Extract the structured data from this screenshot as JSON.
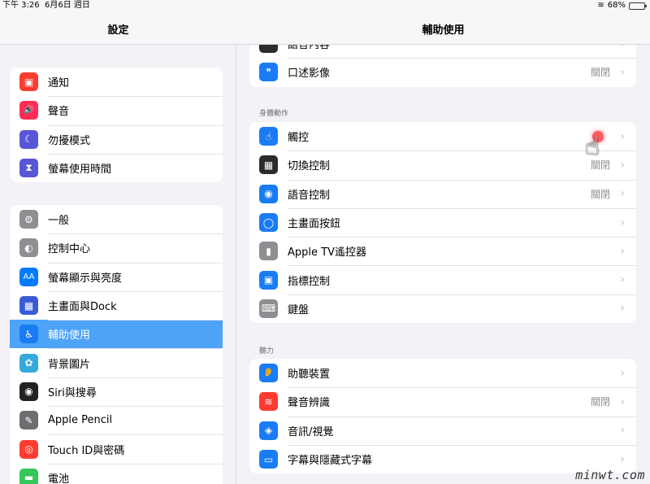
{
  "status": {
    "time": "下午 3:26",
    "date": "6月6日 週日",
    "battery": "68%",
    "battery_level": 0.68
  },
  "left_panel": {
    "title": "設定",
    "group1": [
      {
        "label": "通知",
        "icon": "notification-icon",
        "color": "#ff3b30"
      },
      {
        "label": "聲音",
        "icon": "speaker-icon",
        "color": "#ff2d55"
      },
      {
        "label": "勿擾模式",
        "icon": "moon-icon",
        "color": "#5856d6"
      },
      {
        "label": "螢幕使用時間",
        "icon": "hourglass-icon",
        "color": "#5856d6"
      }
    ],
    "group2": [
      {
        "label": "一般",
        "icon": "gear-icon",
        "color": "#8e8e93"
      },
      {
        "label": "控制中心",
        "icon": "toggles-icon",
        "color": "#8e8e93"
      },
      {
        "label": "螢幕顯示與亮度",
        "icon": "text-size-icon",
        "color": "#007aff"
      },
      {
        "label": "主畫面與Dock",
        "icon": "home-grid-icon",
        "color": "#3a5bd6"
      },
      {
        "label": "輔助使用",
        "icon": "accessibility-icon",
        "color": "#1a7cf5"
      },
      {
        "label": "背景圖片",
        "icon": "flower-icon",
        "color": "#34aadc"
      },
      {
        "label": "Siri與搜尋",
        "icon": "siri-icon",
        "color": "#222"
      },
      {
        "label": "Apple Pencil",
        "icon": "pencil-icon",
        "color": "#6d6d72"
      },
      {
        "label": "Touch ID與密碼",
        "icon": "fingerprint-icon",
        "color": "#ff3b30"
      },
      {
        "label": "電池",
        "icon": "battery-icon",
        "color": "#34c759"
      }
    ]
  },
  "right_panel": {
    "title": "輔助使用",
    "top_group": [
      {
        "label": "語音內容",
        "icon": "speech-bubble-icon",
        "color": "#2c2c2e",
        "value": ""
      },
      {
        "label": "口述影像",
        "icon": "chat-quote-icon",
        "color": "#1a7cf5",
        "value": "關閉"
      }
    ],
    "section_physical": "身體動作",
    "physical_group": [
      {
        "label": "觸控",
        "icon": "hand-touch-icon",
        "color": "#1a7cf5",
        "value": ""
      },
      {
        "label": "切換控制",
        "icon": "switch-grid-icon",
        "color": "#2c2c2e",
        "value": "關閉"
      },
      {
        "label": "語音控制",
        "icon": "voice-control-icon",
        "color": "#1a7cf5",
        "value": "關閉"
      },
      {
        "label": "主畫面按鈕",
        "icon": "home-button-icon",
        "color": "#1a7cf5",
        "value": ""
      },
      {
        "label": "Apple TV遙控器",
        "icon": "remote-icon",
        "color": "#8e8e93",
        "value": ""
      },
      {
        "label": "指標控制",
        "icon": "pointer-icon",
        "color": "#1a7cf5",
        "value": ""
      },
      {
        "label": "鍵盤",
        "icon": "keyboard-icon",
        "color": "#8e8e93",
        "value": ""
      }
    ],
    "section_hearing": "聽力",
    "hearing_group": [
      {
        "label": "助聽裝置",
        "icon": "ear-icon",
        "color": "#1a7cf5",
        "value": ""
      },
      {
        "label": "聲音辨識",
        "icon": "waveform-icon",
        "color": "#ff3b30",
        "value": "關閉"
      },
      {
        "label": "音訊/視覺",
        "icon": "audio-visual-icon",
        "color": "#1a7cf5",
        "value": ""
      },
      {
        "label": "字幕與隱藏式字幕",
        "icon": "captions-icon",
        "color": "#1a7cf5",
        "value": ""
      }
    ]
  },
  "watermark": "minwt.com",
  "glyphs": {
    "notification-icon": "▣",
    "speaker-icon": "🔊",
    "moon-icon": "☾",
    "hourglass-icon": "⧗",
    "gear-icon": "⚙",
    "toggles-icon": "◐",
    "text-size-icon": "AA",
    "home-grid-icon": "▦",
    "accessibility-icon": "♿",
    "flower-icon": "✿",
    "siri-icon": "◉",
    "pencil-icon": "✎",
    "fingerprint-icon": "◎",
    "battery-icon": "▬",
    "speech-bubble-icon": "❝",
    "chat-quote-icon": "❞",
    "hand-touch-icon": "☝",
    "switch-grid-icon": "▦",
    "voice-control-icon": "◉",
    "home-button-icon": "◯",
    "remote-icon": "▮",
    "pointer-icon": "▣",
    "keyboard-icon": "⌨",
    "ear-icon": "👂",
    "waveform-icon": "≋",
    "audio-visual-icon": "◈",
    "captions-icon": "▭"
  }
}
